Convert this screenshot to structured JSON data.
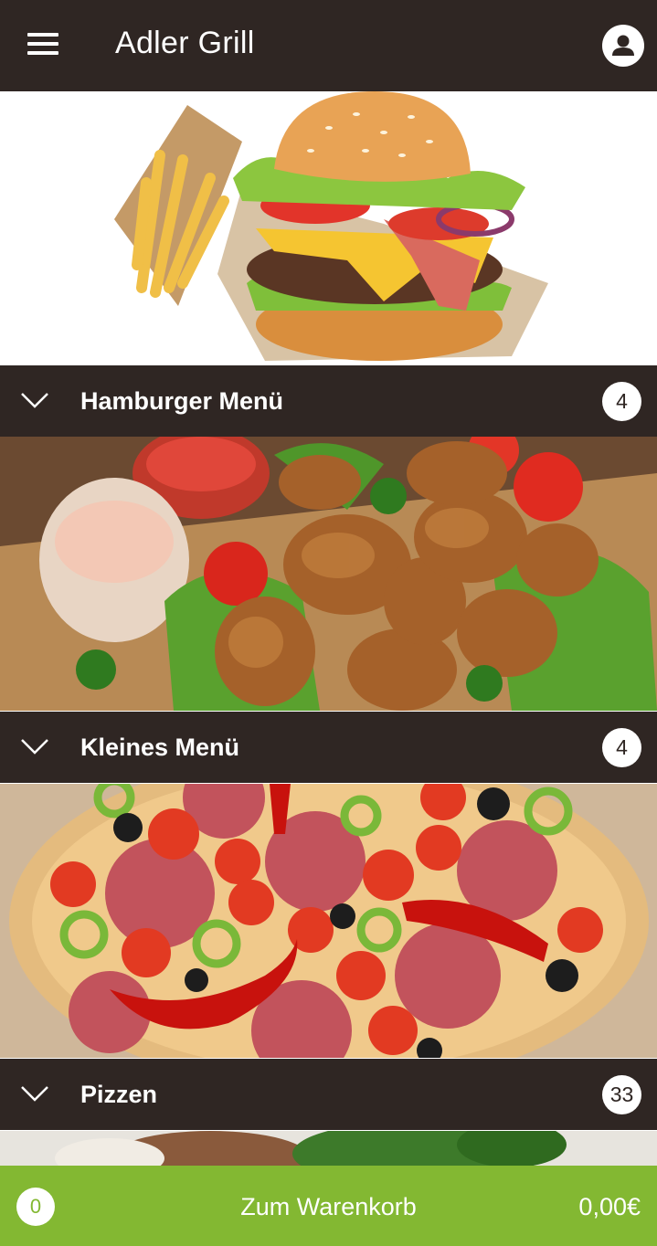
{
  "header": {
    "title": "Adler Grill",
    "menu_icon": "hamburger-menu-icon",
    "account_icon": "user-icon"
  },
  "categories": [
    {
      "name": "Hamburger Menü",
      "count": "4",
      "image": "burger-and-fries-photo"
    },
    {
      "name": "Kleines Menü",
      "count": "4",
      "image": "chicken-nuggets-photo"
    },
    {
      "name": "Pizzen",
      "count": "33",
      "image": "pizza-photo"
    }
  ],
  "next_category_image": "salad-photo",
  "cart": {
    "count": "0",
    "label": "Zum Warenkorb",
    "total": "0,00€"
  },
  "colors": {
    "header_bg": "#2f2623",
    "cart_bg": "#83b832"
  }
}
